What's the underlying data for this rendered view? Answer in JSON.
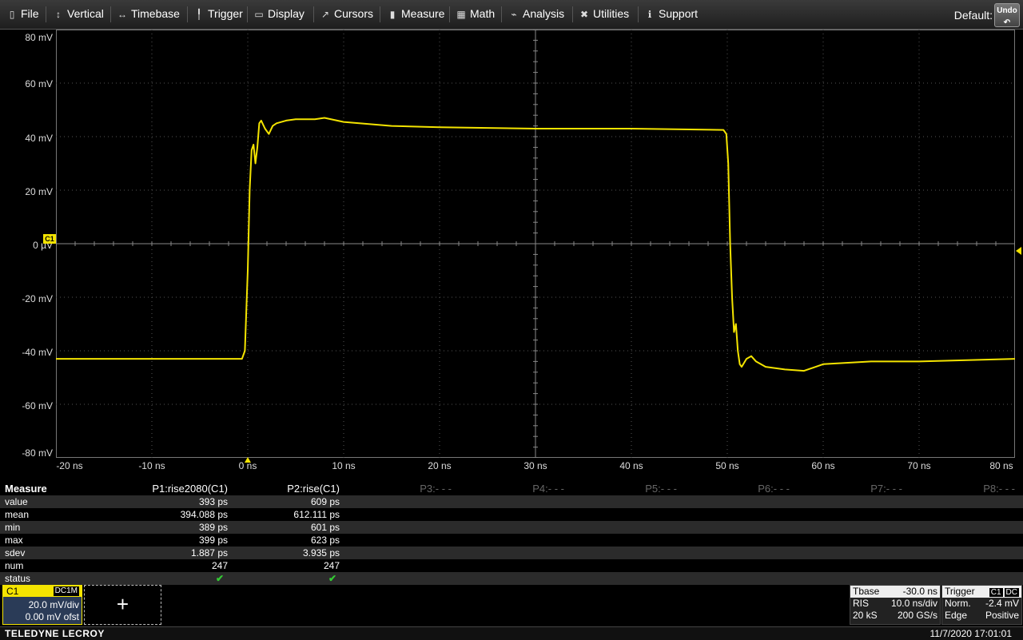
{
  "menu": {
    "items": [
      {
        "label": "File",
        "icon": "clipboard-icon"
      },
      {
        "label": "Vertical",
        "icon": "vertical-arrows-icon"
      },
      {
        "label": "Timebase",
        "icon": "horizontal-arrows-icon"
      },
      {
        "label": "Trigger",
        "icon": "trigger-icon"
      },
      {
        "label": "Display",
        "icon": "display-icon"
      },
      {
        "label": "Cursors",
        "icon": "cursor-icon"
      },
      {
        "label": "Measure",
        "icon": "ruler-icon"
      },
      {
        "label": "Math",
        "icon": "calculator-icon"
      },
      {
        "label": "Analysis",
        "icon": "chart-icon"
      },
      {
        "label": "Utilities",
        "icon": "tools-icon"
      },
      {
        "label": "Support",
        "icon": "info-icon"
      }
    ],
    "default_label": "Default:",
    "undo_label": "Undo"
  },
  "chart_data": {
    "type": "line",
    "title": "",
    "xlabel": "",
    "ylabel": "",
    "x_unit": "ns",
    "y_unit": "mV",
    "xlim": [
      -20,
      80
    ],
    "ylim": [
      -80,
      80
    ],
    "grid": true,
    "x_ticks": [
      "-20 ns",
      "-10 ns",
      "0 ns",
      "10 ns",
      "20 ns",
      "30 ns",
      "40 ns",
      "50 ns",
      "60 ns",
      "70 ns",
      "80 ns"
    ],
    "y_ticks": [
      "80 mV",
      "60 mV",
      "40 mV",
      "20 mV",
      "0 µV",
      "-20 mV",
      "-40 mV",
      "-60 mV",
      "-80 mV"
    ],
    "color": "#f4e400",
    "series": [
      {
        "x": [
          -20,
          -10,
          -2,
          -0.6,
          -0.3,
          0,
          0.2,
          0.4,
          0.6,
          0.8,
          1.0,
          1.2,
          1.4,
          1.8,
          2.2,
          2.6,
          3.0,
          4,
          5,
          6,
          7,
          8,
          10,
          15,
          20,
          30,
          40,
          49.6,
          49.9,
          50.1,
          50.3,
          50.5,
          50.7,
          50.9,
          51.1,
          51.3,
          51.5,
          52,
          52.5,
          53,
          54,
          56,
          58,
          60,
          65,
          70,
          80
        ],
        "y": [
          -43,
          -43,
          -43,
          -43,
          -40,
          -10,
          20,
          35,
          37,
          30,
          36,
          45,
          46,
          43,
          41,
          44,
          45,
          46,
          46.5,
          46.5,
          46.5,
          47,
          45.5,
          44,
          43.5,
          43,
          43,
          42.5,
          41,
          30,
          0,
          -20,
          -33,
          -30,
          -40,
          -45,
          -46,
          -43,
          -42,
          -44,
          -46,
          -47,
          -47.5,
          -45,
          -44,
          -44,
          -43
        ]
      }
    ],
    "channel_marker": "C1"
  },
  "measure": {
    "title": "Measure",
    "columns": [
      "P1:rise2080(C1)",
      "P2:rise(C1)",
      "P3:- - -",
      "P4:- - -",
      "P5:- - -",
      "P6:- - -",
      "P7:- - -",
      "P8:- - -"
    ],
    "rows": [
      {
        "label": "value",
        "p1": "393 ps",
        "p2": "609 ps"
      },
      {
        "label": "mean",
        "p1": "394.088 ps",
        "p2": "612.111 ps"
      },
      {
        "label": "min",
        "p1": "389 ps",
        "p2": "601 ps"
      },
      {
        "label": "max",
        "p1": "399 ps",
        "p2": "623 ps"
      },
      {
        "label": "sdev",
        "p1": "1.887 ps",
        "p2": "3.935 ps"
      },
      {
        "label": "num",
        "p1": "247",
        "p2": "247"
      },
      {
        "label": "status",
        "p1": "✔",
        "p2": "✔"
      }
    ]
  },
  "channel": {
    "name": "C1",
    "coupling": "DC1M",
    "vdiv": "20.0 mV/div",
    "offset": "0.00 mV ofst",
    "add_label": "+"
  },
  "timebase": {
    "label": "Tbase",
    "delay": "-30.0 ns",
    "mode": "RIS",
    "tdiv": "10.0 ns/div",
    "samples": "20 kS",
    "rate": "200 GS/s"
  },
  "trigger": {
    "label": "Trigger",
    "source": "C1",
    "coupling": "DC",
    "mode": "Norm.",
    "level": "-2.4 mV",
    "type": "Edge",
    "slope": "Positive"
  },
  "status": {
    "brand": "TELEDYNE LECROY",
    "datetime": "11/7/2020 17:01:01"
  }
}
